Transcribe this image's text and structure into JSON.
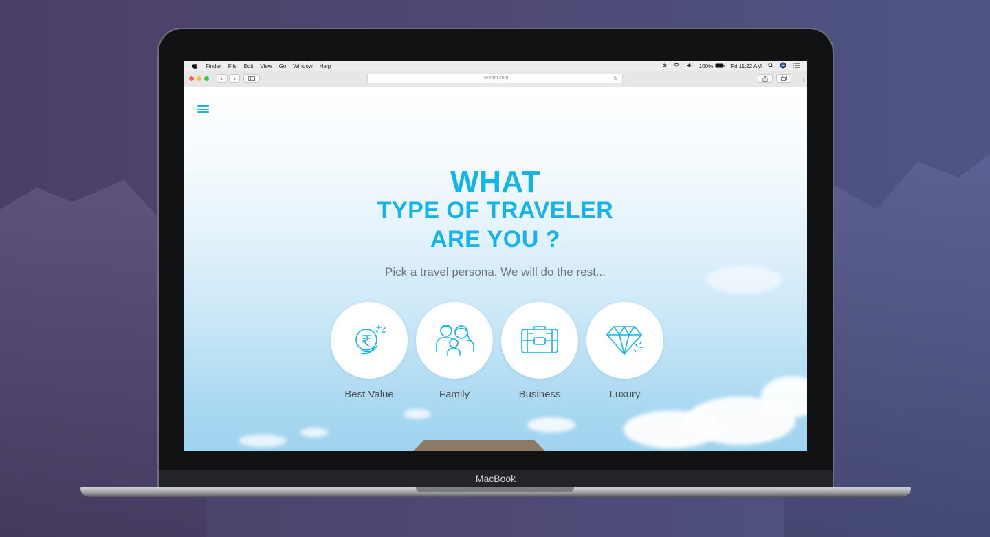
{
  "menubar": {
    "apple_icon": "apple-logo-icon",
    "items": [
      "Finder",
      "File",
      "Edit",
      "View",
      "Go",
      "Window",
      "Help"
    ],
    "battery": "100%",
    "clock": "Fri 11:22 AM"
  },
  "browser": {
    "url": "ToFrom.com",
    "back_glyph": "‹",
    "forward_glyph": "›",
    "new_tab_glyph": "+"
  },
  "page": {
    "headline_1": "WHAT",
    "headline_2": "TYPE OF TRAVELER",
    "headline_3": "ARE YOU ?",
    "subtitle": "Pick a travel persona. We will do the rest...",
    "personas": [
      {
        "label": "Best Value",
        "icon": "rupee-coins-icon"
      },
      {
        "label": "Family",
        "icon": "family-icon"
      },
      {
        "label": "Business",
        "icon": "briefcase-icon"
      },
      {
        "label": "Luxury",
        "icon": "diamond-icon"
      }
    ]
  },
  "device": {
    "label": "MacBook"
  },
  "colors": {
    "accent": "#14b4ea",
    "text": "#4a4d50",
    "subtitle": "#6f7478"
  }
}
